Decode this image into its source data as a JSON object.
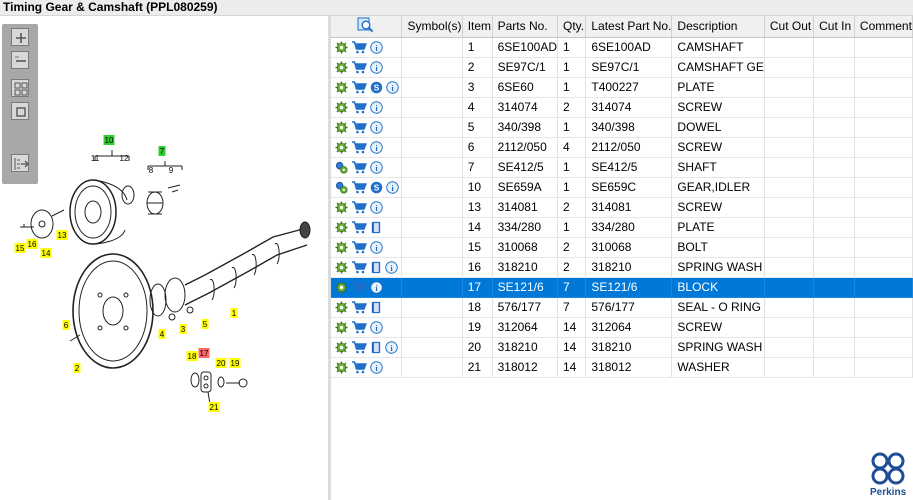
{
  "window": {
    "title": "Timing Gear & Camshaft (PPL080259)"
  },
  "toolbox": {
    "buttons": [
      {
        "name": "zoom-in-icon"
      },
      {
        "name": "zoom-out-icon"
      },
      {
        "name": "fit-to-window-icon"
      },
      {
        "name": "actual-size-icon"
      },
      {
        "name": "export-icon"
      }
    ]
  },
  "diagram": {
    "callouts": [
      "10",
      "11",
      "12",
      "7",
      "8",
      "9",
      "15",
      "16",
      "14",
      "13",
      "6",
      "2",
      "3",
      "4",
      "5",
      "1",
      "18",
      "17",
      "20",
      "19",
      "21"
    ],
    "highlighted_callout": "17",
    "colors": {
      "green": "#33cc33",
      "yellow": "#ffff00",
      "red": "#ff6666"
    }
  },
  "table": {
    "search_icon": "search-icon",
    "columns": [
      "",
      "Symbol(s)",
      "Item",
      "Parts No.",
      "Qty.",
      "Latest Part No.",
      "Description",
      "Cut Out",
      "Cut In",
      "Comment"
    ],
    "rows": [
      {
        "icons": [
          "gear",
          "cart",
          "info"
        ],
        "item": "1",
        "part": "6SE100AD",
        "qty": "1",
        "latest": "6SE100AD",
        "desc": "CAMSHAFT"
      },
      {
        "icons": [
          "gear",
          "cart",
          "info"
        ],
        "item": "2",
        "part": "SE97C/1",
        "qty": "1",
        "latest": "SE97C/1",
        "desc": "CAMSHAFT GE"
      },
      {
        "icons": [
          "gear",
          "cart",
          "s",
          "info"
        ],
        "item": "3",
        "part": "6SE60",
        "qty": "1",
        "latest": "T400227",
        "desc": "PLATE"
      },
      {
        "icons": [
          "gear",
          "cart",
          "info"
        ],
        "item": "4",
        "part": "314074",
        "qty": "2",
        "latest": "314074",
        "desc": "SCREW"
      },
      {
        "icons": [
          "gear",
          "cart",
          "info"
        ],
        "item": "5",
        "part": "340/398",
        "qty": "1",
        "latest": "340/398",
        "desc": "DOWEL"
      },
      {
        "icons": [
          "gear",
          "cart",
          "info"
        ],
        "item": "6",
        "part": "2112/050",
        "qty": "4",
        "latest": "2112/050",
        "desc": "SCREW"
      },
      {
        "icons": [
          "gears",
          "cart",
          "info"
        ],
        "item": "7",
        "part": "SE412/5",
        "qty": "1",
        "latest": "SE412/5",
        "desc": "SHAFT"
      },
      {
        "icons": [
          "gears",
          "cart",
          "s",
          "info"
        ],
        "item": "10",
        "part": "SE659A",
        "qty": "1",
        "latest": "SE659C",
        "desc": "GEAR,IDLER"
      },
      {
        "icons": [
          "gear",
          "cart",
          "info"
        ],
        "item": "13",
        "part": "314081",
        "qty": "2",
        "latest": "314081",
        "desc": "SCREW"
      },
      {
        "icons": [
          "gear",
          "cart",
          "book"
        ],
        "item": "14",
        "part": "334/280",
        "qty": "1",
        "latest": "334/280",
        "desc": "PLATE"
      },
      {
        "icons": [
          "gear",
          "cart",
          "info"
        ],
        "item": "15",
        "part": "310068",
        "qty": "2",
        "latest": "310068",
        "desc": "BOLT"
      },
      {
        "icons": [
          "gear",
          "cart",
          "book",
          "info"
        ],
        "item": "16",
        "part": "318210",
        "qty": "2",
        "latest": "318210",
        "desc": "SPRING WASH"
      },
      {
        "icons": [
          "gear",
          "cart",
          "info"
        ],
        "item": "17",
        "part": "SE121/6",
        "qty": "7",
        "latest": "SE121/6",
        "desc": "BLOCK",
        "selected": true
      },
      {
        "icons": [
          "gear",
          "cart",
          "book"
        ],
        "item": "18",
        "part": "576/177",
        "qty": "7",
        "latest": "576/177",
        "desc": "SEAL - O RING"
      },
      {
        "icons": [
          "gear",
          "cart",
          "info"
        ],
        "item": "19",
        "part": "312064",
        "qty": "14",
        "latest": "312064",
        "desc": "SCREW"
      },
      {
        "icons": [
          "gear",
          "cart",
          "book",
          "info"
        ],
        "item": "20",
        "part": "318210",
        "qty": "14",
        "latest": "318210",
        "desc": "SPRING WASH"
      },
      {
        "icons": [
          "gear",
          "cart",
          "info"
        ],
        "item": "21",
        "part": "318012",
        "qty": "14",
        "latest": "318012",
        "desc": "WASHER"
      }
    ]
  },
  "brand": {
    "name": "Perkins",
    "color": "#1f4e96"
  }
}
